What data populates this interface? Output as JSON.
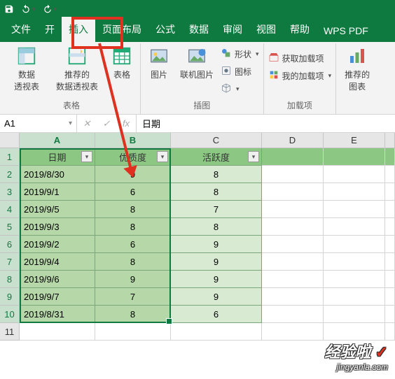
{
  "tabs": {
    "t1": "文件",
    "t2": "开",
    "t3": "插入",
    "t4": "页面布局",
    "t5": "公式",
    "t6": "数据",
    "t7": "审阅",
    "t8": "视图",
    "t9": "帮助",
    "t10": "WPS PDF"
  },
  "ribbon": {
    "group1": {
      "btn1": "数据\n透视表",
      "btn2": "推荐的\n数据透视表",
      "btn3": "表格",
      "label": "表格"
    },
    "group2": {
      "btn1": "图片",
      "btn2": "联机图片",
      "shapes": "形状",
      "icons": "图标",
      "label": "插图"
    },
    "group3": {
      "addins1": "获取加载项",
      "addins2": "我的加载项",
      "label": "加载项"
    },
    "group4": {
      "btn1": "推荐的\n图表"
    }
  },
  "namebox": "A1",
  "fx": "fx",
  "fvalue": "日期",
  "cols": {
    "A": "A",
    "B": "B",
    "C": "C",
    "D": "D",
    "E": "E",
    "F": ""
  },
  "headers": {
    "h1": "日期",
    "h2": "优质度",
    "h3": "活跃度"
  },
  "rows": [
    {
      "n": "1"
    },
    {
      "n": "2",
      "a": "2019/8/30",
      "b": "9",
      "c": "8"
    },
    {
      "n": "3",
      "a": "2019/9/1",
      "b": "6",
      "c": "8"
    },
    {
      "n": "4",
      "a": "2019/9/5",
      "b": "8",
      "c": "7"
    },
    {
      "n": "5",
      "a": "2019/9/3",
      "b": "8",
      "c": "8"
    },
    {
      "n": "6",
      "a": "2019/9/2",
      "b": "6",
      "c": "9"
    },
    {
      "n": "7",
      "a": "2019/9/4",
      "b": "8",
      "c": "9"
    },
    {
      "n": "8",
      "a": "2019/9/6",
      "b": "9",
      "c": "9"
    },
    {
      "n": "9",
      "a": "2019/9/7",
      "b": "7",
      "c": "9"
    },
    {
      "n": "10",
      "a": "2019/8/31",
      "b": "8",
      "c": "6"
    },
    {
      "n": "11"
    }
  ],
  "watermark": {
    "line1": "经验啦",
    "check": "✓",
    "line2": "jingyanla.com"
  }
}
